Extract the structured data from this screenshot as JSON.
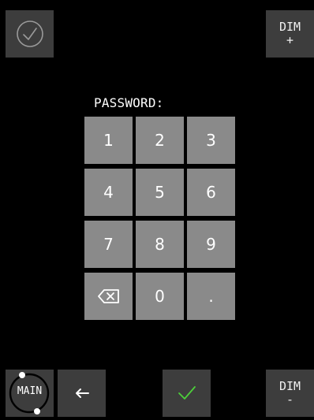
{
  "topbar": {
    "dim_up_label": "DIM\n+"
  },
  "keypad": {
    "title": "PASSWORD:",
    "keys": [
      "1",
      "2",
      "3",
      "4",
      "5",
      "6",
      "7",
      "8",
      "9",
      "0",
      "."
    ],
    "backspace_icon": "backspace-icon"
  },
  "bottombar": {
    "main_label": "MAIN",
    "dim_down_label": "DIM\n-",
    "back_icon": "left-arrow-icon",
    "confirm_icon": "checkmark-icon"
  },
  "colors": {
    "background": "#000000",
    "panel_button": "#3d3d3d",
    "key": "#8a8a8a",
    "accent_green": "#4ccf3a"
  }
}
